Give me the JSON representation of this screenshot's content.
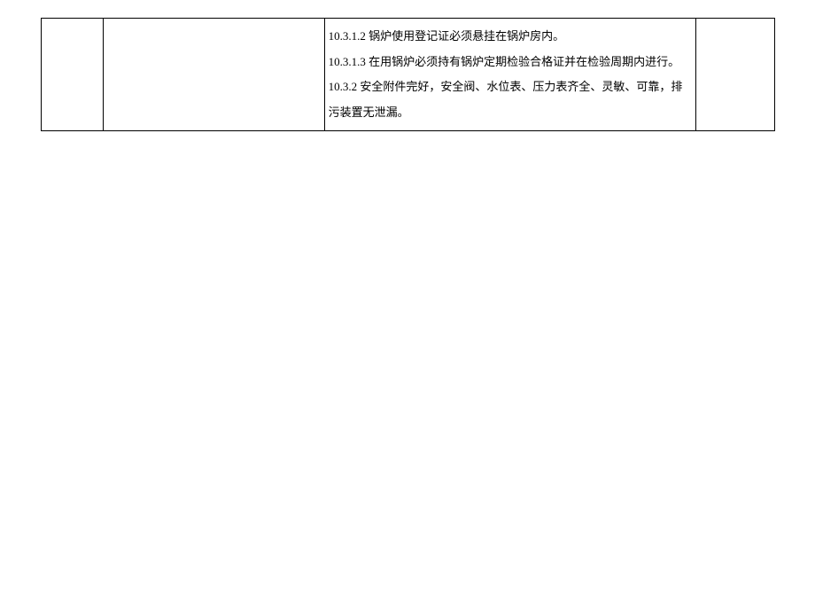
{
  "table": {
    "col1": "",
    "col2": "",
    "col3_lines": [
      "10.3.1.2 锅炉使用登记证必须悬挂在锅炉房内。",
      "10.3.1.3 在用锅炉必须持有锅炉定期检验合格证并在检验周期内进行。",
      "10.3.2 安全附件完好，安全阀、水位表、压力表齐全、灵敏、可靠，排污装置无泄漏。"
    ],
    "col4": ""
  }
}
